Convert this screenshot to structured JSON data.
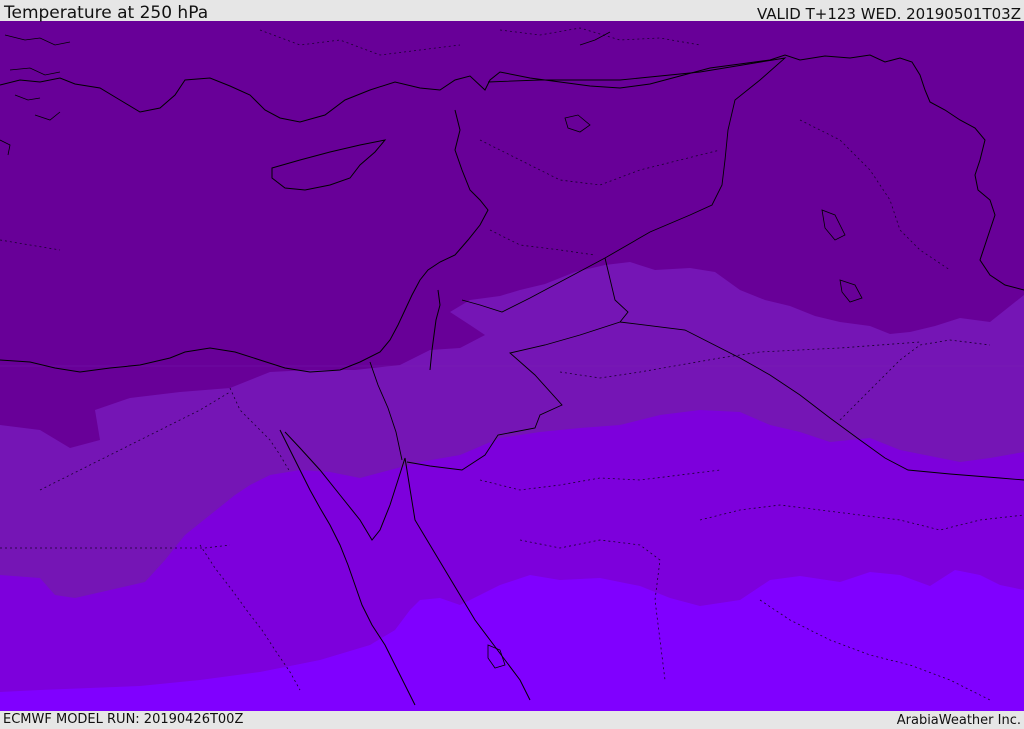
{
  "header": {
    "title": "Temperature at 250 hPa",
    "valid_time": "VALID T+123 WED. 20190501T03Z"
  },
  "footer": {
    "model_run": "ECMWF MODEL RUN: 20190426T00Z",
    "brand": "ArabiaWeather Inc."
  },
  "map": {
    "variable": "temperature",
    "level": "250 hPa",
    "shading_colors": [
      "#680098",
      "#7515b5",
      "#7d00dc",
      "#8000ff"
    ],
    "coastline_color": "#000000",
    "border_style": "solid",
    "internal_border_style": "dotted"
  }
}
